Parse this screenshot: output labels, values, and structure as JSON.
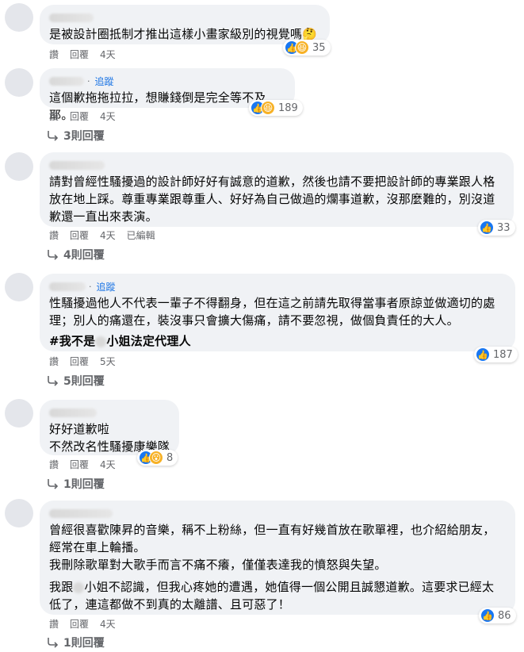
{
  "comments": [
    {
      "text_lines": [
        "是被設計圈抵制才推出這樣小畫家級別的視覺嗎🤔"
      ],
      "reaction_count": "35",
      "reactions": [
        "like-icon",
        "haha-icon",
        "thinking-icon"
      ],
      "actions": [
        "讚",
        "回覆",
        "4天"
      ],
      "reply_label": ""
    },
    {
      "follow_label": "追蹤",
      "text_lines": [
        "這個歉拖拖拉拉，想賺錢倒是完全等不及耶。"
      ],
      "reaction_count": "189",
      "reactions": [
        "like-icon",
        "haha-icon"
      ],
      "actions": [
        "讚",
        "回覆",
        "4天"
      ],
      "reply_label": "3則回覆"
    },
    {
      "text_lines": [
        "請對曾經性騷擾過的設計師好好有誠意的道歉，然後也請不要把設計師的專業跟人格",
        "放在地上踩。尊重專業跟尊重人、好好為自己做過的爛事道歉，沒那麼難的，別沒道",
        "歉還一直出來表演。"
      ],
      "reaction_count": "33",
      "reactions": [
        "like-icon"
      ],
      "actions": [
        "讚",
        "回覆",
        "4天",
        "已編輯"
      ],
      "reply_label": "4則回覆"
    },
    {
      "follow_label": "追蹤",
      "text_lines": [
        "性騷擾過他人不代表一輩子不得翻身，但在這之前請先取得當事者原諒並做適切的處",
        "理；別人的痛還在，裝沒事只會擴大傷痛，請不要忽視，做個負責任的大人。"
      ],
      "hashtag_pre": "#我不是",
      "hashtag_post": "小姐法定代理人",
      "reaction_count": "187",
      "reactions": [
        "like-icon"
      ],
      "actions": [
        "讚",
        "回覆",
        "5天"
      ],
      "reply_label": "5則回覆"
    },
    {
      "text_lines": [
        "好好道歉啦",
        "不然改名性騷擾康樂隊"
      ],
      "reaction_count": "8",
      "reactions": [
        "like-icon",
        "wow-icon"
      ],
      "actions": [
        "讚",
        "回覆",
        "4天"
      ],
      "reply_label": "1則回覆"
    },
    {
      "text_lines": [
        "曾經很喜歡陳昇的音樂，稱不上粉絲，但一直有好幾首放在歌單裡，也介紹給朋友，",
        "經常在車上輪播。",
        "我刪除歌單對大歌手而言不痛不癢，僅僅表達我的憤怒與失望。"
      ],
      "text_b_pre": "我跟",
      "text_b_post": "小姐不認識，但我心疼她的遭遇，她值得一個公開且誠懇道歉。這要求已經太",
      "text_b_line2": "低了，連這都做不到真的太離譜、且可惡了！",
      "reaction_count": "86",
      "reactions": [
        "like-icon"
      ],
      "actions": [
        "讚",
        "回覆",
        "4天"
      ],
      "reply_label": "1則回覆"
    }
  ]
}
